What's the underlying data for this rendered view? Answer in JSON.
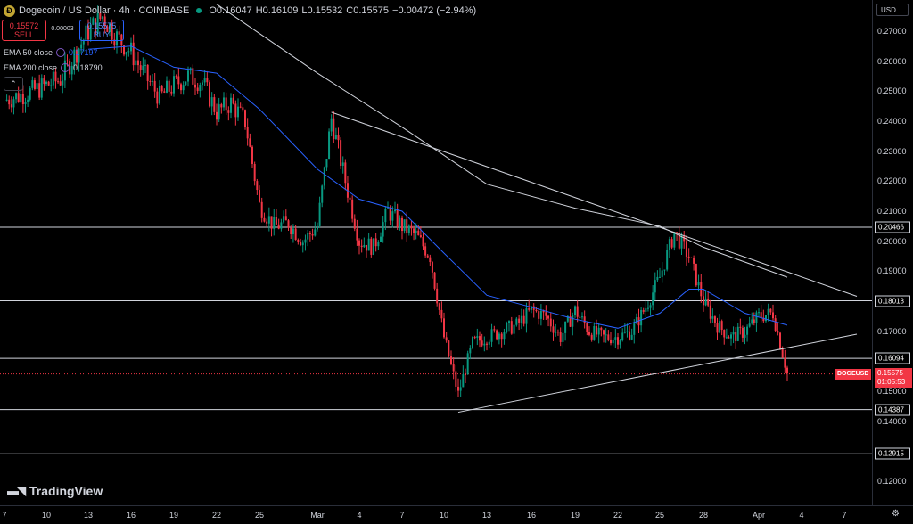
{
  "header": {
    "title": "Dogecoin / US Dollar · 4h · COINBASE",
    "open_label": "O",
    "open": "0.16047",
    "high_label": "H",
    "high": "0.16109",
    "low_label": "L",
    "low": "0.15532",
    "close_label": "C",
    "close": "0.15575",
    "change": "−0.00472 (−2.94%)"
  },
  "trade": {
    "sell_price": "0.15572",
    "sell_label": "SELL",
    "spread": "0.00003",
    "buy_price": "0.15575",
    "buy_label": "BUY"
  },
  "indicators": [
    {
      "label": "EMA 50 close",
      "value": "0.17197"
    },
    {
      "label": "EMA 200 close",
      "value": "0.18790"
    }
  ],
  "currency": "USD",
  "price_axis": {
    "ticks": [
      "0.27000",
      "0.26000",
      "0.25000",
      "0.24000",
      "0.23000",
      "0.22000",
      "0.21000",
      "0.20000",
      "0.19000",
      "0.17000",
      "0.15000",
      "0.14000",
      "0.12000"
    ],
    "tick_values": [
      0.27,
      0.26,
      0.25,
      0.24,
      0.23,
      0.22,
      0.21,
      0.2,
      0.19,
      0.17,
      0.15,
      0.14,
      0.12
    ]
  },
  "levels": [
    "0.20466",
    "0.18013",
    "0.16094",
    "0.14387",
    "0.12915"
  ],
  "level_values": [
    0.20466,
    0.18013,
    0.16094,
    0.14387,
    0.12915
  ],
  "last_price": {
    "symbol": "DOGEUSD",
    "price": "0.15575",
    "countdown": "01:05:53"
  },
  "time_axis": [
    "7",
    "10",
    "13",
    "16",
    "19",
    "22",
    "25",
    "Mar",
    "4",
    "7",
    "10",
    "13",
    "16",
    "19",
    "22",
    "25",
    "28",
    "Apr",
    "4",
    "7"
  ],
  "brand": "TradingView",
  "colors": {
    "up": "#089981",
    "down": "#f23645",
    "ema50": "#2962ff",
    "ema200": "#d1d4dc",
    "bg": "#000000"
  },
  "chart_data": {
    "type": "candlestick",
    "title": "Dogecoin / US Dollar · 4h · COINBASE",
    "ylim": [
      0.112,
      0.277
    ],
    "x_ticks": [
      "7",
      "10",
      "13",
      "16",
      "19",
      "22",
      "25",
      "Mar",
      "4",
      "7",
      "10",
      "13",
      "16",
      "19",
      "22",
      "25",
      "28",
      "Apr",
      "4",
      "7"
    ],
    "close_path": [
      {
        "x": "7",
        "y": 0.247
      },
      {
        "x": "9",
        "y": 0.25
      },
      {
        "x": "10",
        "y": 0.252
      },
      {
        "x": "11",
        "y": 0.254
      },
      {
        "x": "12",
        "y": 0.262
      },
      {
        "x": "13",
        "y": 0.27
      },
      {
        "x": "14",
        "y": 0.275
      },
      {
        "x": "15",
        "y": 0.268
      },
      {
        "x": "16",
        "y": 0.263
      },
      {
        "x": "17",
        "y": 0.255
      },
      {
        "x": "18",
        "y": 0.248
      },
      {
        "x": "19",
        "y": 0.252
      },
      {
        "x": "20",
        "y": 0.255
      },
      {
        "x": "21",
        "y": 0.253
      },
      {
        "x": "22",
        "y": 0.243
      },
      {
        "x": "23",
        "y": 0.246
      },
      {
        "x": "24",
        "y": 0.24
      },
      {
        "x": "25",
        "y": 0.212
      },
      {
        "x": "26",
        "y": 0.205
      },
      {
        "x": "27",
        "y": 0.206
      },
      {
        "x": "28",
        "y": 0.2
      },
      {
        "x": "Mar 1",
        "y": 0.205
      },
      {
        "x": "Mar 2",
        "y": 0.241
      },
      {
        "x": "Mar 3",
        "y": 0.22
      },
      {
        "x": "Mar 4",
        "y": 0.2
      },
      {
        "x": "Mar 5",
        "y": 0.198
      },
      {
        "x": "Mar 6",
        "y": 0.21
      },
      {
        "x": "Mar 7",
        "y": 0.205
      },
      {
        "x": "Mar 8",
        "y": 0.202
      },
      {
        "x": "Mar 9",
        "y": 0.195
      },
      {
        "x": "Mar 10",
        "y": 0.168
      },
      {
        "x": "Mar 11",
        "y": 0.149
      },
      {
        "x": "Mar 12",
        "y": 0.166
      },
      {
        "x": "Mar 13",
        "y": 0.168
      },
      {
        "x": "Mar 14",
        "y": 0.17
      },
      {
        "x": "Mar 15",
        "y": 0.172
      },
      {
        "x": "Mar 16",
        "y": 0.177
      },
      {
        "x": "Mar 17",
        "y": 0.175
      },
      {
        "x": "Mar 18",
        "y": 0.168
      },
      {
        "x": "Mar 19",
        "y": 0.177
      },
      {
        "x": "Mar 20",
        "y": 0.17
      },
      {
        "x": "Mar 21",
        "y": 0.168
      },
      {
        "x": "Mar 22",
        "y": 0.168
      },
      {
        "x": "Mar 23",
        "y": 0.17
      },
      {
        "x": "Mar 24",
        "y": 0.178
      },
      {
        "x": "Mar 25",
        "y": 0.188
      },
      {
        "x": "Mar 26",
        "y": 0.203
      },
      {
        "x": "Mar 27",
        "y": 0.195
      },
      {
        "x": "Mar 28",
        "y": 0.18
      },
      {
        "x": "Mar 29",
        "y": 0.172
      },
      {
        "x": "Mar 30",
        "y": 0.168
      },
      {
        "x": "Mar 31",
        "y": 0.17
      },
      {
        "x": "Apr 1",
        "y": 0.175
      },
      {
        "x": "Apr 2",
        "y": 0.176
      },
      {
        "x": "Apr 3",
        "y": 0.156
      }
    ],
    "ema50": [
      {
        "x": "13",
        "y": 0.264
      },
      {
        "x": "16",
        "y": 0.265
      },
      {
        "x": "19",
        "y": 0.258
      },
      {
        "x": "22",
        "y": 0.256
      },
      {
        "x": "25",
        "y": 0.244
      },
      {
        "x": "Mar 1",
        "y": 0.224
      },
      {
        "x": "Mar 4",
        "y": 0.214
      },
      {
        "x": "Mar 7",
        "y": 0.21
      },
      {
        "x": "Mar 10",
        "y": 0.196
      },
      {
        "x": "Mar 13",
        "y": 0.182
      },
      {
        "x": "Mar 16",
        "y": 0.178
      },
      {
        "x": "Mar 19",
        "y": 0.174
      },
      {
        "x": "Mar 22",
        "y": 0.171
      },
      {
        "x": "Mar 25",
        "y": 0.176
      },
      {
        "x": "Mar 27",
        "y": 0.184
      },
      {
        "x": "Mar 28",
        "y": 0.184
      },
      {
        "x": "Mar 31",
        "y": 0.176
      },
      {
        "x": "Apr 3",
        "y": 0.172
      }
    ],
    "ema200": [
      {
        "x": "22",
        "y": 0.279
      },
      {
        "x": "Mar 1",
        "y": 0.256
      },
      {
        "x": "Mar 7",
        "y": 0.238
      },
      {
        "x": "Mar 13",
        "y": 0.219
      },
      {
        "x": "Mar 19",
        "y": 0.211
      },
      {
        "x": "Mar 25",
        "y": 0.205
      },
      {
        "x": "Mar 28",
        "y": 0.198
      },
      {
        "x": "Apr 3",
        "y": 0.188
      }
    ],
    "trendlines": [
      {
        "from": {
          "x": "Mar 2",
          "y": 0.243
        },
        "to": {
          "x": "Apr 6",
          "y": 0.184
        }
      },
      {
        "from": {
          "x": "Mar 11",
          "y": 0.143
        },
        "to": {
          "x": "Apr 6",
          "y": 0.168
        }
      }
    ],
    "horizontal_levels": [
      0.20466,
      0.18013,
      0.16094,
      0.14387,
      0.12915
    ],
    "last_price": 0.15575
  }
}
